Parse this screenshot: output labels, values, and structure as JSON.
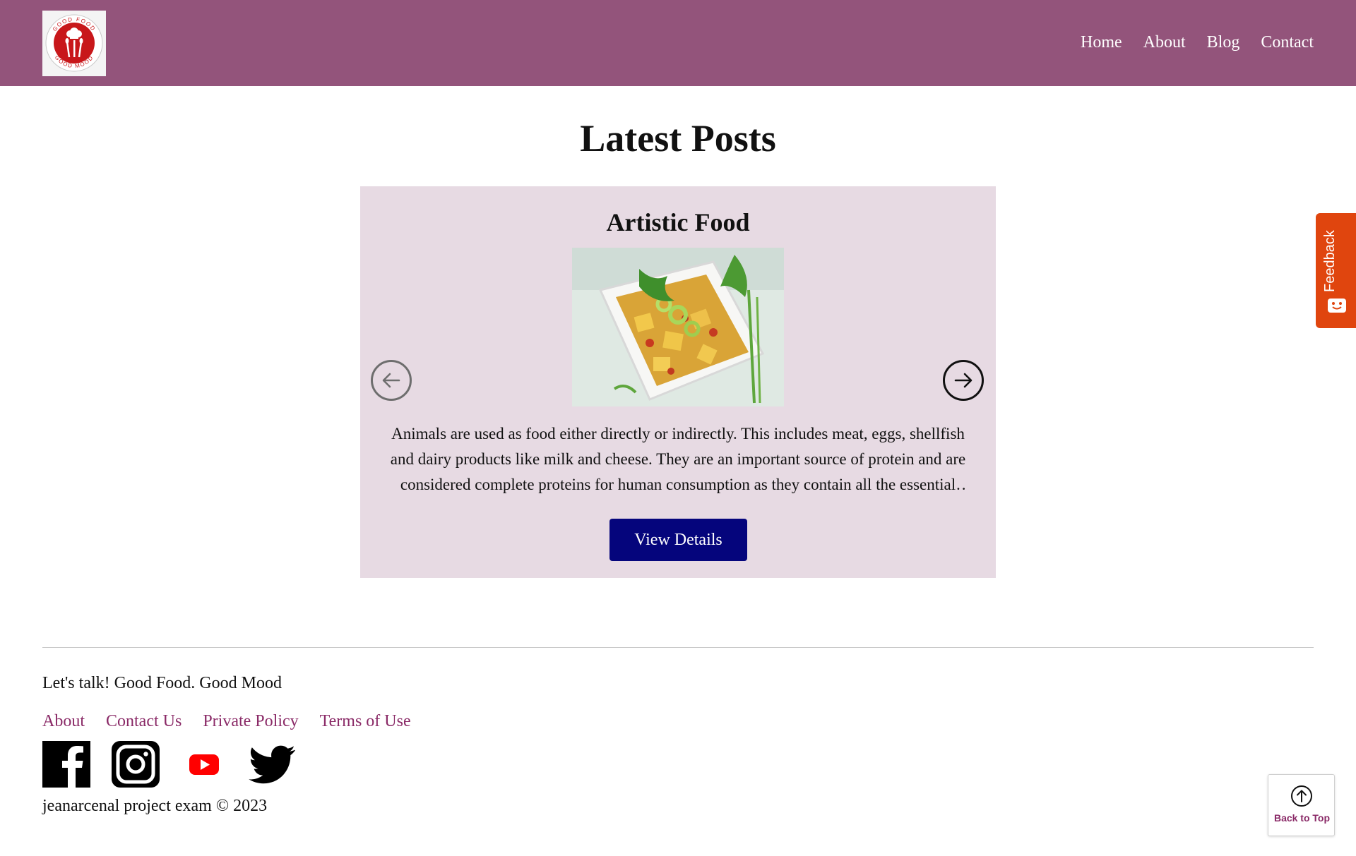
{
  "header": {
    "logo_text_top": "GOOD FOOD",
    "logo_text_bottom": "GOOD MOOD",
    "nav": [
      "Home",
      "About",
      "Blog",
      "Contact"
    ]
  },
  "main": {
    "title": "Latest Posts",
    "post": {
      "title": "Artistic Food",
      "excerpt": "Animals are used as food either directly or indirectly. This includes meat, eggs, shellfish and dairy products like milk and cheese. They are an important source of protein and are considered complete proteins for human consumption as they contain all the essential amino acids.",
      "button_label": "View Details"
    },
    "icons": {
      "prev": "arrow-left-circle-icon",
      "next": "arrow-right-circle-icon"
    }
  },
  "feedback": {
    "label": "Feedback"
  },
  "footer": {
    "tagline": "Let's talk! Good Food. Good Mood",
    "links": [
      "About",
      "Contact Us",
      "Private Policy",
      "Terms of Use"
    ],
    "social": [
      "facebook-icon",
      "instagram-icon",
      "youtube-icon",
      "twitter-icon"
    ],
    "copyright": "jeanarcenal project exam © 2023",
    "back_to_top": "Back to Top"
  },
  "colors": {
    "header_bg": "#93547b",
    "card_bg": "#e7dae3",
    "button_bg": "#05057c",
    "link_color": "#8a2a67",
    "feedback_bg": "#e0450e"
  }
}
